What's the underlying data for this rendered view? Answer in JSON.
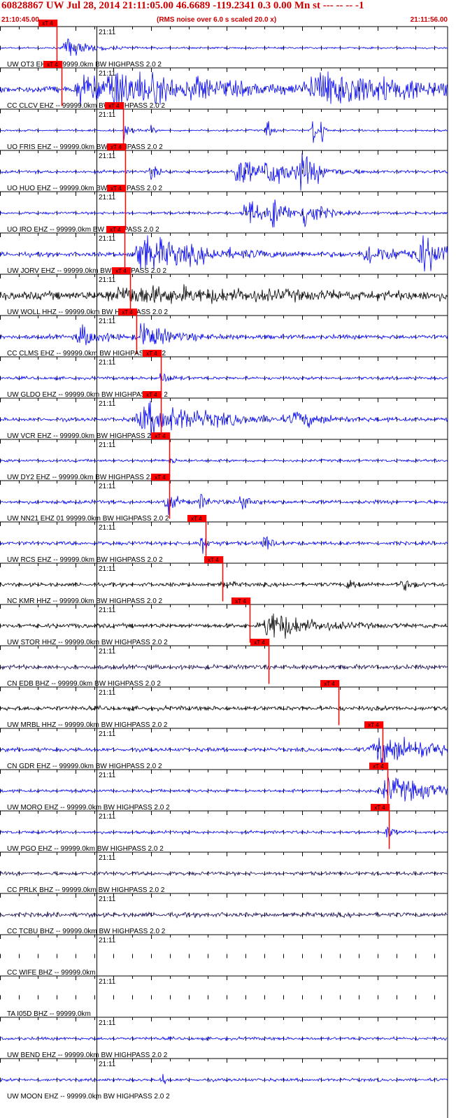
{
  "header": {
    "title": "60828867 UW Jul 28, 2014 21:11:05.00   46.6689 -119.2341  0.3 0.00 Mn st --- -- --  -1",
    "time_start": "21:10:45.00",
    "note": "(RMS noise over 6.0 s scaled 20.0 x)",
    "time_end": "21:11:56.00"
  },
  "colors": {
    "header": "#cc0000",
    "pick": "#ff0000",
    "blue": "#0000ee",
    "black": "#000000",
    "purple": "#1a0a55",
    "grid": "#000000"
  },
  "chart_data": {
    "type": "line",
    "x_axis": {
      "start": "21:10:45.00",
      "end": "21:11:56.00",
      "minute_label": "21:11"
    },
    "pick_label": "xT 4",
    "traces": [
      {
        "label": "UW OT3 EHZ -- 99999.0km BW  HIGHPASS  2.0  2",
        "color": "blue",
        "pick": 0.127,
        "base": 0.05,
        "events": [
          [
            0.15,
            0.55,
            0.045
          ]
        ],
        "clip": false
      },
      {
        "label": "CC CLCV EHZ -- 99999.0km BW  HIGHPASS  2.0  2",
        "color": "blue",
        "pick": 0.137,
        "base": 0.18,
        "events": [
          [
            0.18,
            1.0,
            0.04
          ],
          [
            0.26,
            1.0,
            0.18
          ],
          [
            0.44,
            0.5,
            0.02
          ],
          [
            0.72,
            1.0,
            0.21
          ]
        ],
        "clip": true
      },
      {
        "label": "UO FRIS EHZ -- 99999.0km BW  HIGHPASS  2.0  2",
        "color": "blue",
        "pick": 0.275,
        "base": 0.05,
        "events": [
          [
            0.28,
            0.6,
            0.01
          ],
          [
            0.34,
            0.4,
            0.004
          ],
          [
            0.6,
            0.8,
            0.006
          ],
          [
            0.7,
            0.9,
            0.006
          ],
          [
            0.72,
            0.9,
            0.004
          ]
        ],
        "clip": false
      },
      {
        "label": "UO HUO EHZ -- 99999.0km BW  HIGHPASS  2.0  2",
        "color": "blue",
        "pick": 0.28,
        "base": 0.08,
        "events": [
          [
            0.34,
            0.6,
            0.01
          ],
          [
            0.53,
            1.0,
            0.04
          ],
          [
            0.6,
            1.0,
            0.04
          ],
          [
            0.67,
            1.0,
            0.04
          ]
        ],
        "clip": true
      },
      {
        "label": "UO IRO EHZ -- 99999.0km BW  HIGHPASS  2.0  2",
        "color": "blue",
        "pick": 0.28,
        "base": 0.07,
        "events": [
          [
            0.55,
            1.0,
            0.03
          ],
          [
            0.61,
            0.9,
            0.03
          ],
          [
            0.68,
            1.0,
            0.03
          ]
        ],
        "clip": true
      },
      {
        "label": "UW JORV EHZ -- 99999.0km BW  HIGHPASS  2.0  2",
        "color": "blue",
        "pick": 0.278,
        "base": 0.12,
        "events": [
          [
            0.32,
            1.0,
            0.12
          ],
          [
            0.82,
            0.5,
            0.08
          ],
          [
            0.94,
            1.0,
            0.05
          ]
        ],
        "clip": true
      },
      {
        "label": "UW WOLL HHZ -- 99999.0km BW  HIGHPASS  2.0  2",
        "color": "black",
        "pick": 0.29,
        "base": 0.22,
        "events": [
          [
            0.28,
            0.4,
            0.28
          ]
        ],
        "clip": false
      },
      {
        "label": "CC CLMS EHZ -- 99999.0km BW  HIGHPASS  2.0  2",
        "color": "blue",
        "pick": 0.305,
        "base": 0.12,
        "events": [
          [
            0.18,
            0.6,
            0.04
          ],
          [
            0.32,
            0.8,
            0.05
          ]
        ],
        "clip": false
      },
      {
        "label": "UW GLDO EHZ -- 99999.0km BW  HIGHPASS  2.0  2",
        "color": "blue",
        "pick": 0.36,
        "base": 0.08,
        "events": [
          [
            0.36,
            0.35,
            0.02
          ]
        ],
        "clip": false
      },
      {
        "label": "UW VCR EHZ -- 99999.0km BW  HIGHPASS  2.0  2",
        "color": "blue",
        "pick": 0.36,
        "base": 0.1,
        "events": [
          [
            0.33,
            0.9,
            0.14
          ],
          [
            0.66,
            0.4,
            0.05
          ]
        ],
        "clip": false
      },
      {
        "label": "UW DY2 EHZ -- 99999.0km BW  HIGHPASS  2.0  2",
        "color": "blue",
        "pick": 0.378,
        "base": 0.07,
        "events": [
          [
            0.38,
            0.3,
            0.01
          ]
        ],
        "clip": false
      },
      {
        "label": "UW NN21 EHZ 01 99999.0km BW  HIGHPASS  2.0  2",
        "color": "blue",
        "pick": 0.378,
        "base": 0.1,
        "events": [
          [
            0.37,
            0.6,
            0.02
          ],
          [
            0.45,
            0.4,
            0.015
          ],
          [
            0.54,
            0.5,
            0.02
          ]
        ],
        "clip": false
      },
      {
        "label": "UW RCS EHZ -- 99999.0km BW  HIGHPASS  2.0  2",
        "color": "blue",
        "pick": 0.46,
        "base": 0.1,
        "events": [
          [
            0.45,
            0.6,
            0.015
          ],
          [
            0.59,
            0.5,
            0.015
          ]
        ],
        "clip": false
      },
      {
        "label": "NC KMR HHZ -- 99999.0km BW  HIGHPASS  2.0  2",
        "color": "black",
        "pick": 0.497,
        "base": 0.1,
        "events": [
          [
            0.5,
            0.25,
            0.015
          ],
          [
            0.78,
            0.3,
            0.02
          ],
          [
            0.9,
            0.25,
            0.03
          ]
        ],
        "clip": false
      },
      {
        "label": "UW STOR HHZ -- 99999.0km BW  HIGHPASS  2.0  2",
        "color": "black",
        "pick": 0.558,
        "base": 0.12,
        "events": [
          [
            0.6,
            0.9,
            0.07
          ]
        ],
        "clip": false
      },
      {
        "label": "CN EDB BHZ -- 99999.0km BW  HIGHPASS  2.0  2",
        "color": "purple",
        "pick": 0.6,
        "base": 0.12,
        "events": [],
        "clip": false
      },
      {
        "label": "UW MRBL HHZ -- 99999.0km BW  HIGHPASS  2.0  2",
        "color": "black",
        "pick": 0.757,
        "base": 0.12,
        "events": [],
        "clip": false
      },
      {
        "label": "CN GDR EHZ -- 99999.0km BW  HIGHPASS  2.0  2",
        "color": "blue",
        "pick": 0.855,
        "base": 0.1,
        "events": [
          [
            0.85,
            0.9,
            0.12
          ]
        ],
        "clip": false
      },
      {
        "label": "UW MORO EHZ -- 99999.0km BW  HIGHPASS  2.0  2",
        "color": "blue",
        "pick": 0.865,
        "base": 0.08,
        "events": [
          [
            0.87,
            0.7,
            0.12
          ]
        ],
        "clip": false
      },
      {
        "label": "UW PGO EHZ -- 99999.0km BW  HIGHPASS  2.0  2",
        "color": "blue",
        "pick": 0.868,
        "base": 0.08,
        "events": [
          [
            0.865,
            0.45,
            0.01
          ]
        ],
        "clip": false
      },
      {
        "label": "CC PRLK BHZ -- 99999.0km BW  HIGHPASS  2.0  2",
        "color": "purple",
        "pick": null,
        "base": 0.1,
        "events": [],
        "clip": false
      },
      {
        "label": "CC TCBU BHZ -- 99999.0km BW  HIGHPASS  2.0  2",
        "color": "purple",
        "pick": null,
        "base": 0.12,
        "events": [],
        "clip": false
      },
      {
        "label": "CC WIFE BHZ -- 99999.0km",
        "color": "blue",
        "pick": null,
        "base": 0.0,
        "events": [],
        "clip": false
      },
      {
        "label": "TA I05D BHZ -- 99999.0km",
        "color": "blue",
        "pick": null,
        "base": 0.0,
        "events": [],
        "clip": false
      },
      {
        "label": "UW BEND EHZ -- 99999.0km BW  HIGHPASS  2.0  2",
        "color": "blue",
        "pick": null,
        "base": 0.08,
        "events": [],
        "clip": false
      },
      {
        "label": "UW MOON EHZ -- 99999.0km BW  HIGHPASS  2.0  2",
        "color": "blue",
        "pick": null,
        "base": 0.08,
        "events": [
          [
            0.365,
            0.4,
            0.005
          ]
        ],
        "clip": false
      }
    ]
  }
}
